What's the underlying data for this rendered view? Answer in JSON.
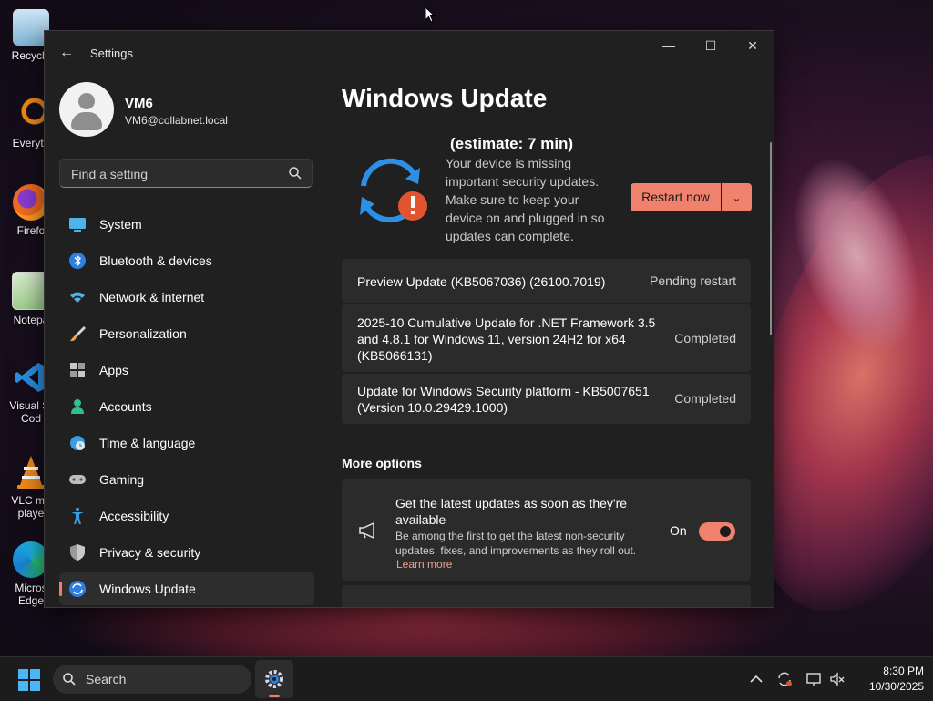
{
  "desktop": {
    "icons": [
      {
        "label": "Recycle"
      },
      {
        "label": "Everyth"
      },
      {
        "label": "Firefo"
      },
      {
        "label": "Notepa"
      },
      {
        "label": "Visual St\nCod"
      },
      {
        "label": "VLC me\nplaye"
      },
      {
        "label": "Micros\nEdge"
      }
    ]
  },
  "window": {
    "title": "Settings",
    "controls": {
      "minimize": "—",
      "maximize": "☐",
      "close": "✕"
    }
  },
  "profile": {
    "name": "VM6",
    "email": "VM6@collabnet.local"
  },
  "search": {
    "placeholder": "Find a setting"
  },
  "nav": {
    "items": [
      {
        "label": "System",
        "icon": "monitor-icon"
      },
      {
        "label": "Bluetooth & devices",
        "icon": "bluetooth-icon"
      },
      {
        "label": "Network & internet",
        "icon": "wifi-icon"
      },
      {
        "label": "Personalization",
        "icon": "brush-icon"
      },
      {
        "label": "Apps",
        "icon": "apps-icon"
      },
      {
        "label": "Accounts",
        "icon": "person-icon"
      },
      {
        "label": "Time & language",
        "icon": "globe-icon"
      },
      {
        "label": "Gaming",
        "icon": "gamepad-icon"
      },
      {
        "label": "Accessibility",
        "icon": "accessibility-icon"
      },
      {
        "label": "Privacy & security",
        "icon": "shield-icon"
      },
      {
        "label": "Windows Update",
        "icon": "update-icon",
        "active": true
      }
    ]
  },
  "main": {
    "title": "Windows Update",
    "status": {
      "estimate": "(estimate: 7 min)",
      "description": "Your device is missing important security updates. Make sure to keep your device on and plugged in so updates can complete."
    },
    "restart_button": "Restart now",
    "updates": [
      {
        "name": "Preview Update (KB5067036) (26100.7019)",
        "status": "Pending restart"
      },
      {
        "name": "2025-10 Cumulative Update for .NET Framework 3.5 and 4.8.1 for Windows 11, version 24H2 for x64 (KB5066131)",
        "status": "Completed"
      },
      {
        "name": "Update for Windows Security platform - KB5007651 (Version 10.0.29429.1000)",
        "status": "Completed"
      }
    ],
    "more_options": {
      "title": "More options",
      "latest_updates": {
        "title": "Get the latest updates as soon as they're available",
        "description": "Be among the first to get the latest non-security updates, fixes, and improvements as they roll out.",
        "link": "Learn more",
        "toggle_label": "On",
        "toggle_on": true
      }
    }
  },
  "taskbar": {
    "search_label": "Search",
    "time": "8:30 PM",
    "date": "10/30/2025"
  },
  "colors": {
    "accent": "#f0826d",
    "window_bg": "#202020",
    "card_bg": "#2b2b2b"
  }
}
